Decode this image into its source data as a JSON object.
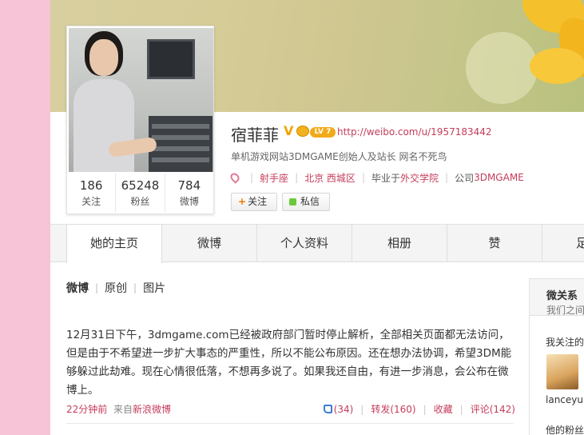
{
  "profile": {
    "name": "宿菲菲",
    "verified_mark": "V",
    "level": "LV 7",
    "url": "http://weibo.com/u/1957183442",
    "bio": "单机游戏网站3DMGAME创始人及站长 网名不死鸟",
    "zodiac": "射手座",
    "location": "北京 西城区",
    "school_prefix": "毕业于",
    "school": "外交学院",
    "company_prefix": "公司",
    "company": "3DMGAME",
    "stats": [
      {
        "num": "186",
        "label": "关注"
      },
      {
        "num": "65248",
        "label": "粉丝"
      },
      {
        "num": "784",
        "label": "微博"
      }
    ],
    "follow_label": "关注",
    "message_label": "私信"
  },
  "tabs": [
    "她的主页",
    "微博",
    "个人资料",
    "相册",
    "赞",
    "足"
  ],
  "feed_tabs": [
    "微博",
    "原创",
    "图片"
  ],
  "post": {
    "text": "12月31日下午，3dmgame.com已经被政府部门暂时停止解析，全部相关页面都无法访问，但是由于不希望进一步扩大事态的严重性，所以不能公布原因。还在想办法协调，希望3DM能够躲过此劫难。现在心情很低落，不想再多说了。如果我还自由，有进一步消息，会公布在微博上。",
    "time": "22分钟前",
    "via_prefix": "来自",
    "source": "新浪微博",
    "likes": "(34)",
    "repost": "转发(160)",
    "favorite": "收藏",
    "comment": "评论(142)"
  },
  "sidebar": {
    "title": "微关系",
    "subtitle": "我们之间",
    "follows_label": "我关注的",
    "user": "lanceyu...",
    "fans_label": "他的粉丝"
  },
  "icons": {
    "verified": "verified-v-icon",
    "crown": "crown-icon",
    "tag": "tag-icon",
    "like": "thumbs-up-icon",
    "message": "message-icon"
  },
  "colors": {
    "accent": "#c43d5a",
    "background_side": "#f6c4d6",
    "badge": "#f2a91a"
  }
}
